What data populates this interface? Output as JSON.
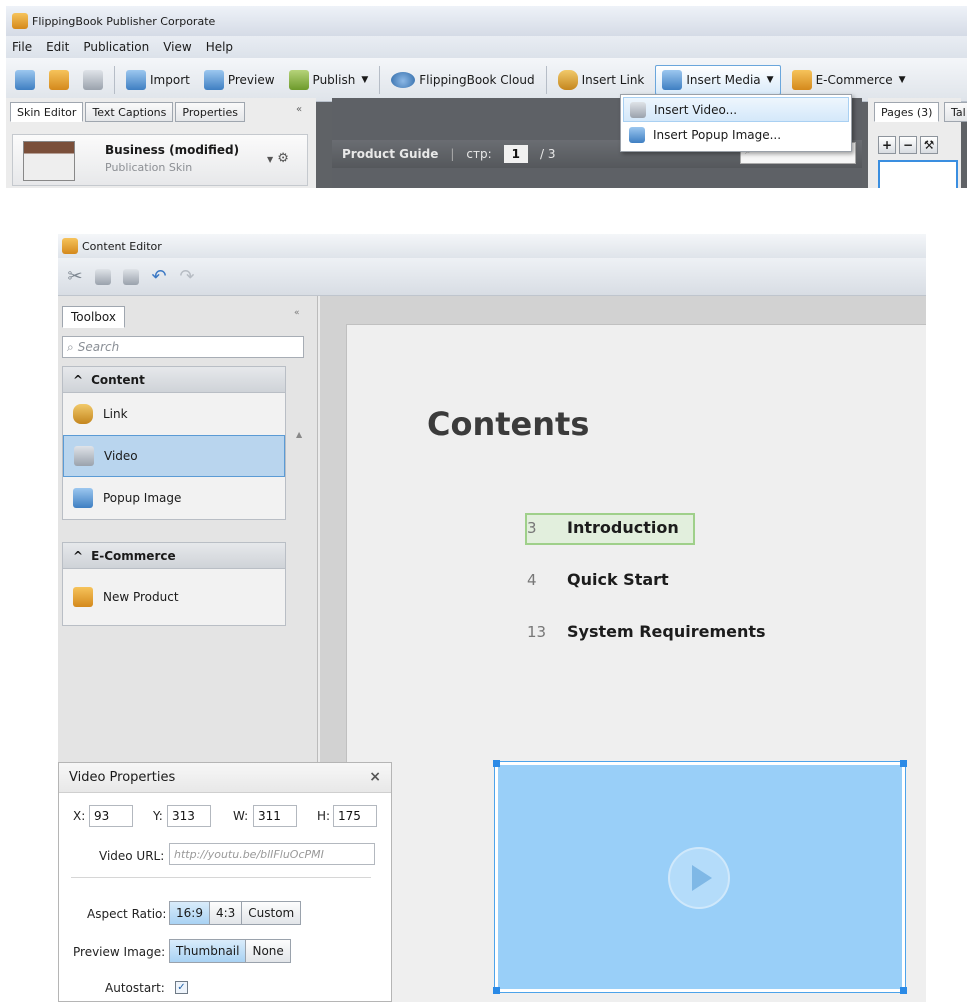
{
  "publisher": {
    "title": "FlippingBook Publisher Corporate",
    "menu": [
      "File",
      "Edit",
      "Publication",
      "View",
      "Help"
    ],
    "toolbar": {
      "import": "Import",
      "preview": "Preview",
      "publish": "Publish",
      "cloud": "FlippingBook Cloud",
      "insert_link": "Insert Link",
      "insert_media": "Insert Media",
      "ecommerce": "E-Commerce"
    },
    "left_tabs": [
      "Skin Editor",
      "Text Captions",
      "Properties"
    ],
    "collapse_glyph": "«",
    "skin": {
      "name": "Business (modified)",
      "subtitle": "Publication Skin"
    },
    "page_bar": {
      "title": "Product Guide",
      "page_label": "стр:",
      "page": "1",
      "total": "/ 3"
    },
    "right_tab": "Pages (3)",
    "right_tab_2": "Tal",
    "media_menu": [
      "Insert Video...",
      "Insert Popup Image..."
    ]
  },
  "content_editor": {
    "title": "Content Editor",
    "toolbox": {
      "tab": "Toolbox",
      "collapse_glyph": "«",
      "search_placeholder": "Search",
      "sections": [
        {
          "title": "Content",
          "items": [
            "Link",
            "Video",
            "Popup Image"
          ]
        },
        {
          "title": "E-Commerce",
          "items": [
            "New Product"
          ]
        }
      ],
      "selected_item": "Video"
    },
    "page": {
      "heading": "Contents",
      "toc": [
        {
          "num": "3",
          "label": "Introduction"
        },
        {
          "num": "4",
          "label": "Quick Start"
        },
        {
          "num": "13",
          "label": "System Requirements"
        }
      ]
    }
  },
  "video_properties": {
    "title": "Video Properties",
    "x_label": "X:",
    "x": "93",
    "y_label": "Y:",
    "y": "313",
    "w_label": "W:",
    "w": "311",
    "h_label": "H:",
    "h": "175",
    "url_label": "Video URL:",
    "url": "http://youtu.be/blIFluOcPMI",
    "aspect_label": "Aspect Ratio:",
    "aspect_options": [
      "16:9",
      "4:3",
      "Custom"
    ],
    "aspect_selected": "16:9",
    "preview_label": "Preview Image:",
    "preview_options": [
      "Thumbnail",
      "None"
    ],
    "preview_selected": "Thumbnail",
    "autostart_label": "Autostart:",
    "autostart": true
  },
  "icons": {
    "close": "×",
    "check": "✓",
    "caret": "▼",
    "caret_up": "^",
    "gear": "⚙",
    "search": "⌕",
    "plus": "+",
    "minus": "−",
    "wrench": "⚒",
    "cut": "✂",
    "undo": "↶",
    "redo": "↷"
  },
  "colors": {
    "selection_blue": "#99cff8",
    "accent": "#2b8ae6",
    "toc_highlight": "#9fd08a"
  }
}
